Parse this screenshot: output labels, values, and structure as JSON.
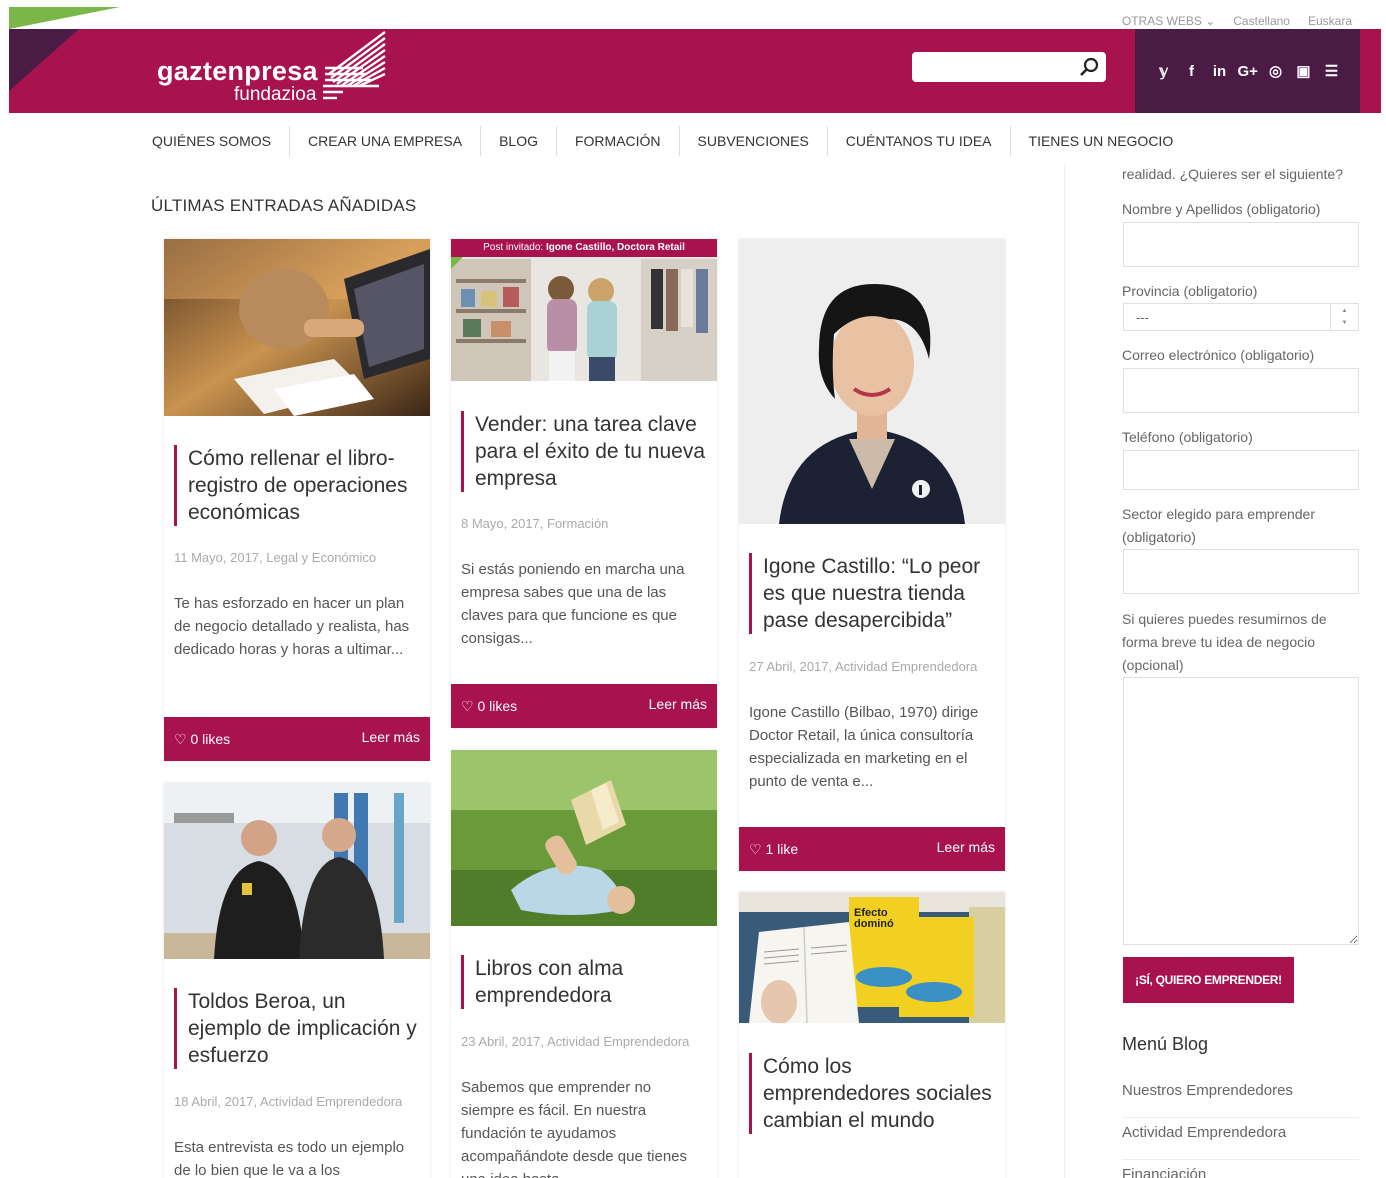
{
  "utility": {
    "other_webs": "OTRAS WEBS ⌄",
    "lang_es": "Castellano",
    "lang_eu": "Euskara"
  },
  "logo": {
    "word": "gaztenpresa",
    "sub": "fundazioa"
  },
  "search": {
    "placeholder": ""
  },
  "social": [
    "𝕪",
    "f",
    "in",
    "G+",
    "◎",
    "▣",
    "☰"
  ],
  "nav": [
    "QUIÉNES SOMOS",
    "CREAR UNA EMPRESA",
    "BLOG",
    "FORMACIÓN",
    "SUBVENCIONES",
    "CUÉNTANOS TU IDEA",
    "TIENES UN NEGOCIO"
  ],
  "section_title": "ÚLTIMAS ENTRADAS AÑADIDAS",
  "cards": [
    {
      "title": "Cómo rellenar el libro-registro de operaciones económicas",
      "meta": "11 Mayo, 2017, Legal y Económico",
      "excerpt": "Te has esforzado en hacer un plan de negocio detallado y realista, has dedicado horas y horas a ultimar...",
      "likes": "♡ 0 likes",
      "more": "Leer más"
    },
    {
      "banner_prefix": "Post invitado: ",
      "banner_author": "Igone Castillo, Doctora Retail",
      "title": "Vender: una tarea clave para el éxito de tu nueva empresa",
      "meta": "8 Mayo, 2017, Formación",
      "excerpt": "Si estás poniendo en marcha una empresa sabes que una de las claves para que funcione es que consigas...",
      "likes": "♡ 0 likes",
      "more": "Leer más"
    },
    {
      "title": "Igone Castillo: “Lo peor es que nuestra tienda pase desapercibida”",
      "meta": "27 Abril, 2017, Actividad Emprendedora",
      "excerpt": "Igone Castillo (Bilbao, 1970) dirige Doctor Retail, la única consultoría especializada en marketing en el punto de venta e...",
      "likes": "♡ 1 like",
      "more": "Leer más"
    },
    {
      "title": "Toldos Beroa, un ejemplo de implicación y esfuerzo",
      "meta": "18 Abril, 2017, Actividad Emprendedora",
      "excerpt": "Esta entrevista es todo un ejemplo de lo bien que le va a los"
    },
    {
      "title": "Libros con alma emprendedora",
      "meta": "23 Abril, 2017, Actividad Emprendedora",
      "excerpt": "Sabemos que emprender no siempre es fácil. En nuestra fundación te ayudamos acompañándote desde que tienes una idea hasta"
    },
    {
      "title": "Cómo los emprendedores sociales cambian el mundo",
      "book_text_1": "Efecto",
      "book_text_2": "dominó"
    }
  ],
  "sidebar": {
    "intro": "realidad. ¿Quieres ser el siguiente?",
    "name_label": "Nombre y Apellidos (obligatorio)",
    "province_label": "Provincia (obligatorio)",
    "province_value": "---",
    "email_label": "Correo electrónico (obligatorio)",
    "phone_label": "Teléfono (obligatorio)",
    "sector_label": "Sector elegido para emprender (obligatorio)",
    "idea_label": "Si quieres puedes resumirnos de forma breve tu idea de negocio (opcional)",
    "submit": "¡SÍ, QUIERO EMPRENDER!",
    "menu_title": "Menú Blog",
    "menu_items": [
      "Nuestros Emprendedores",
      "Actividad Emprendedora",
      "Financiación"
    ]
  },
  "colors": {
    "brand": "#a8124f",
    "brand_dark": "#4a1c45",
    "accent_green": "#7ab648"
  }
}
